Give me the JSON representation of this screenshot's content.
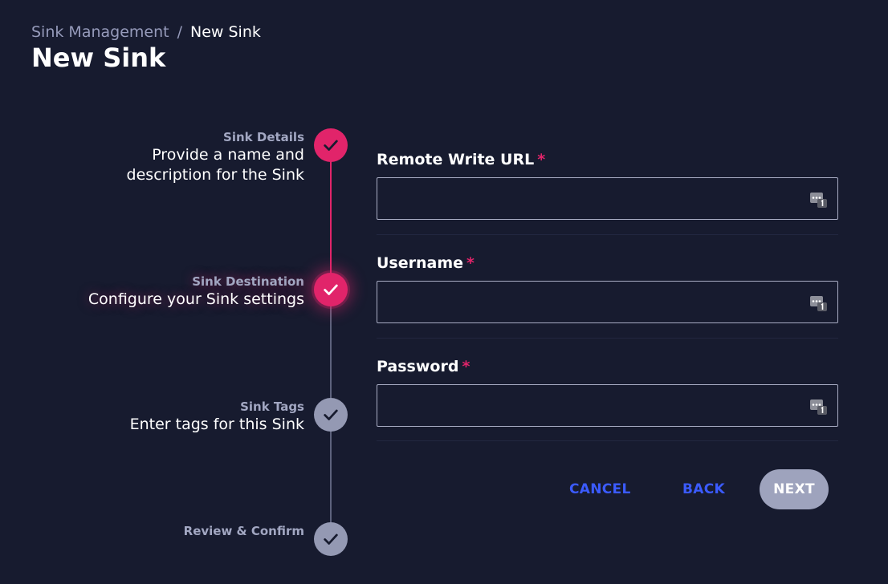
{
  "breadcrumb": {
    "parent": "Sink Management",
    "separator": "/",
    "current": "New Sink"
  },
  "page_title": "New Sink",
  "stepper": {
    "steps": [
      {
        "title": "Sink Details",
        "description_lines": [
          "Provide a name and",
          "description for the Sink"
        ],
        "state": "complete",
        "icon": "check-icon"
      },
      {
        "title": "Sink Destination",
        "description_lines": [
          "Configure your Sink settings"
        ],
        "state": "active",
        "icon": "check-icon"
      },
      {
        "title": "Sink Tags",
        "description_lines": [
          "Enter tags for this Sink"
        ],
        "state": "pending",
        "icon": "check-icon"
      },
      {
        "title": "Review & Confirm",
        "description_lines": [],
        "state": "pending",
        "icon": "check-icon"
      }
    ]
  },
  "form": {
    "fields": [
      {
        "label": "Remote Write URL",
        "required_mark": "*",
        "value": "",
        "icon": "password-manager-icon"
      },
      {
        "label": "Username",
        "required_mark": "*",
        "value": "",
        "icon": "password-manager-icon"
      },
      {
        "label": "Password",
        "required_mark": "*",
        "value": "",
        "icon": "password-manager-icon"
      }
    ]
  },
  "actions": {
    "cancel_label": "CANCEL",
    "back_label": "BACK",
    "next_label": "NEXT"
  },
  "colors": {
    "background": "#171b2f",
    "accent": "#e1246a",
    "pending": "#9499b3",
    "link": "#3b5bff",
    "button_disabled": "#9ea3bd"
  }
}
